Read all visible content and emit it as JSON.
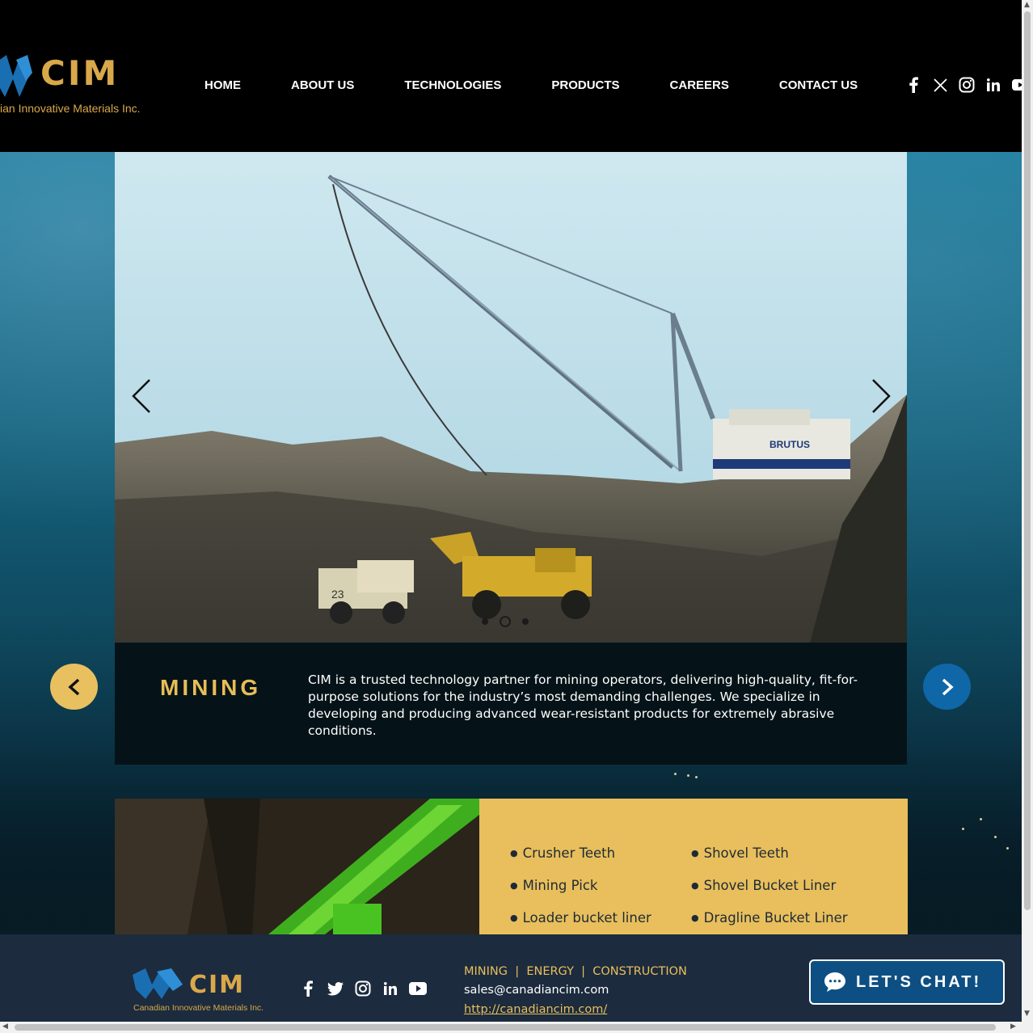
{
  "header": {
    "logo_text": "CIM",
    "logo_sub": "ian Innovative Materials Inc.",
    "nav": [
      "HOME",
      "ABOUT US",
      "TECHNOLOGIES",
      "PRODUCTS",
      "CAREERS",
      "CONTACT US"
    ],
    "social_icons": [
      "facebook-icon",
      "x-icon",
      "instagram-icon",
      "linkedin-icon",
      "youtube-icon"
    ]
  },
  "slider": {
    "machine_label": "BRUTUS",
    "truck_number": "23",
    "dots": 3,
    "active_dot": 2
  },
  "caption": {
    "title": "MINING",
    "text": "CIM is a trusted technology partner for mining operators, delivering high-quality, fit-for-purpose solutions for the industry’s most demanding challenges. We specialize in developing and producing advanced wear-resistant products for extremely abrasive conditions."
  },
  "products": {
    "col1": [
      "Crusher Teeth",
      "Mining Pick",
      "Loader bucket liner"
    ],
    "col2": [
      "Shovel Teeth",
      "Shovel Bucket Liner",
      "Dragline Bucket Liner"
    ]
  },
  "footer": {
    "logo_text": "CIM",
    "logo_sub": "Canadian Innovative Materials Inc.",
    "categories": "MINING  |  ENERGY  |  CONSTRUCTION",
    "email": "sales@canadiancim.com",
    "url": "http://canadiancim.com/"
  },
  "chat": {
    "label": "LET'S CHAT!"
  },
  "colors": {
    "gold": "#e8bf5c",
    "blue": "#0f67a8",
    "footer": "#1c2b3e"
  }
}
